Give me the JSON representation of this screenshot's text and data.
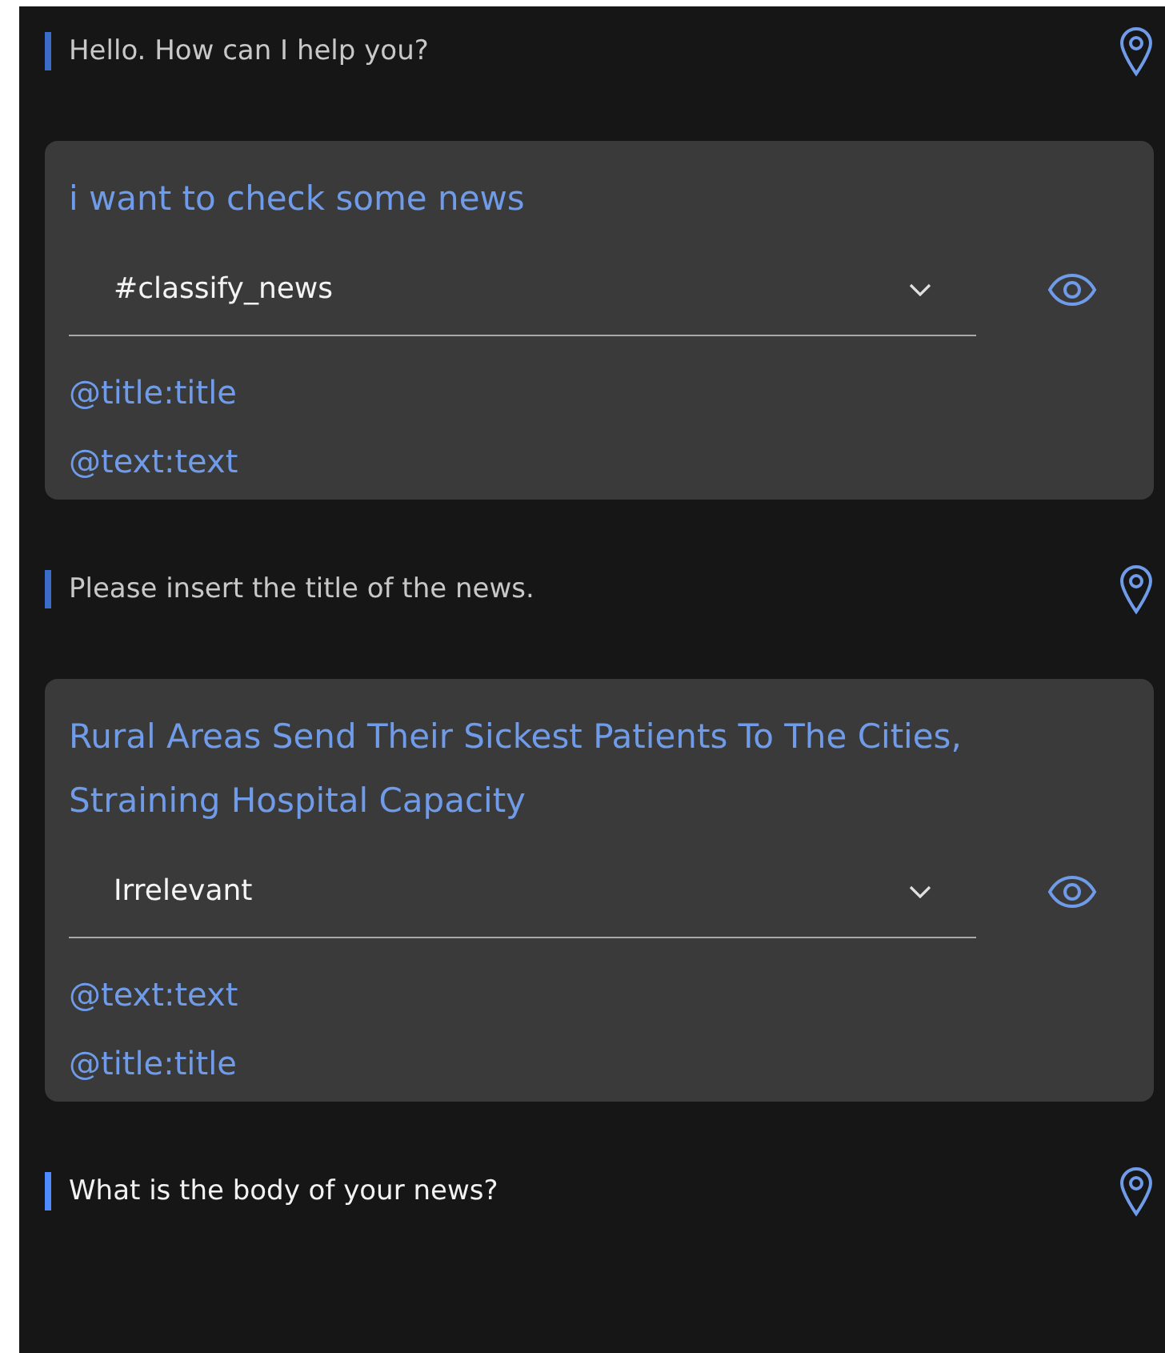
{
  "conversation": [
    {
      "kind": "bot",
      "text": "Hello. How can I help you?",
      "active": false
    },
    {
      "kind": "user",
      "text": "i want to check some news",
      "intent": "#classify_news",
      "entities": [
        "@title:title",
        "@text:text"
      ]
    },
    {
      "kind": "bot",
      "text": "Please insert the title of the news.",
      "active": false
    },
    {
      "kind": "user",
      "text": "Rural Areas Send Their Sickest Patients To The Cities, Straining Hospital Capacity",
      "intent": "Irrelevant",
      "entities": [
        "@text:text",
        "@title:title"
      ]
    },
    {
      "kind": "bot",
      "text": "What is the body of your news?",
      "active": true
    }
  ]
}
